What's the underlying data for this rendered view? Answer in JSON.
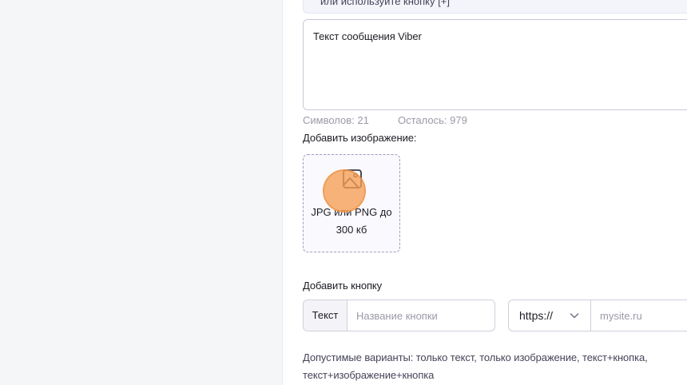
{
  "hint": {
    "text": "или используйте кнопку [+]"
  },
  "message": {
    "value": "Текст сообщения Viber"
  },
  "counters": {
    "symbols": "Символов: 21",
    "remaining": "Осталось: 979"
  },
  "image_upload": {
    "label": "Добавить изображение:",
    "hint": "JPG или PNG до 300 кб",
    "icon": "image-icon"
  },
  "button_section": {
    "label": "Добавить кнопку",
    "text_addon": "Текст",
    "name_placeholder": "Название кнопки",
    "protocol": "https://",
    "url_placeholder": "mysite.ru"
  },
  "note": {
    "text": "Допустимые варианты: только текст, только изображение, текст+кнопка, текст+изображение+кнопка"
  },
  "colors": {
    "cursor": "#f59e52",
    "upload_border": "#9d9dc0"
  }
}
